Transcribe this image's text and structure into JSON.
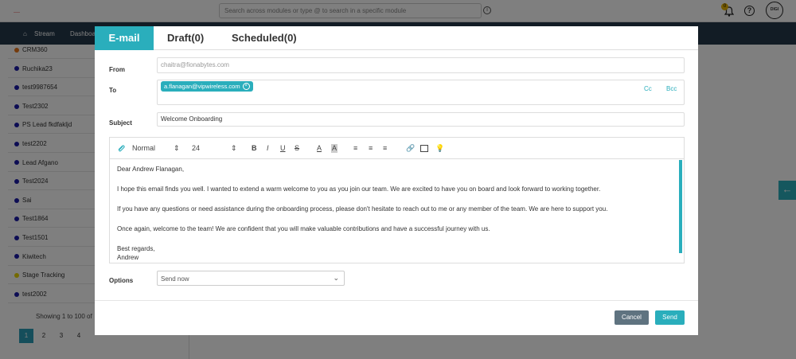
{
  "app": {
    "search_placeholder": "Search across modules or type @ to search in a specific module",
    "notification_count": "0",
    "help_glyph": "?",
    "avatar_text": "DIGI",
    "logo_text": "——"
  },
  "nav": {
    "items": [
      "Stream",
      "Dashboa"
    ]
  },
  "sidebar": {
    "items": [
      {
        "label": "CRM360",
        "color": "#e8761a"
      },
      {
        "label": "Ruchika23",
        "color": "#1a1aa8"
      },
      {
        "label": "test9987654",
        "color": "#1a1aa8"
      },
      {
        "label": "Test2302",
        "color": "#1a1aa8"
      },
      {
        "label": "PS Lead fkdfakljd",
        "color": "#1a1aa8"
      },
      {
        "label": "test2202",
        "color": "#1a1aa8"
      },
      {
        "label": "Lead Afgano",
        "color": "#1a1aa8"
      },
      {
        "label": "Test2024",
        "color": "#1a1aa8"
      },
      {
        "label": "Sai",
        "color": "#1a1aa8"
      },
      {
        "label": "Test1864",
        "color": "#1a1aa8"
      },
      {
        "label": "Test1501",
        "color": "#1a1aa8"
      },
      {
        "label": "Kiwitech",
        "color": "#1a1aa8"
      },
      {
        "label": "Stage Tracking",
        "color": "#e8d400"
      },
      {
        "label": "test2002",
        "color": "#1a1aa8"
      }
    ],
    "showing": "Showing 1 to 100 of",
    "pages": [
      "1",
      "2",
      "3",
      "4"
    ]
  },
  "modal": {
    "tabs": [
      "E-mail",
      "Draft(0)",
      "Scheduled(0)"
    ],
    "from_label": "From",
    "from_value": "chaitra@fionabytes.com",
    "to_label": "To",
    "to_chip": "a.flanagan@vipwireless.com",
    "cc_label": "Cc",
    "bcc_label": "Bcc",
    "subject_label": "Subject",
    "subject_value": "Welcome Onboarding",
    "toolbar": {
      "format": "Normal",
      "size": "24"
    },
    "body": {
      "greeting": "Dear Andrew Flanagan,",
      "p1": "I hope this email finds you well. I wanted to extend a warm welcome to you as you join our team. We are excited to have you on board and look forward to working together.",
      "p2": "If you have any questions or need assistance during the onboarding process, please don't hesitate to reach out to me or any member of the team. We are here to support you.",
      "p3": "Once again, welcome to the team! We are confident that you will make valuable contributions and have a successful journey with us.",
      "closing": "Best regards,",
      "signature": "Andrew"
    },
    "options_label": "Options",
    "options_value": "Send now",
    "cancel_label": "Cancel",
    "send_label": "Send"
  },
  "colors": {
    "accent": "#2aaebc",
    "nav_bg": "#24384a",
    "cancel_bg": "#5f7380"
  }
}
